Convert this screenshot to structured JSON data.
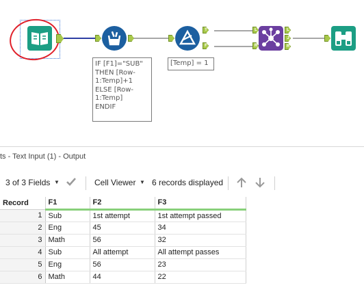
{
  "workflow": {
    "tools": [
      {
        "name": "Text Input",
        "icon": "text-input-book-icon",
        "color": "#1c9e84"
      },
      {
        "name": "Multi-Row Formula",
        "icon": "multi-row-formula-icon",
        "color": "#1c5fa0"
      },
      {
        "name": "Filter",
        "icon": "filter-icon",
        "color": "#1c5fa0"
      },
      {
        "name": "Join",
        "icon": "join-icon",
        "color": "#6b3fa0"
      },
      {
        "name": "Browse",
        "icon": "binoculars-browse-icon",
        "color": "#1c9e84"
      }
    ],
    "anchors": {
      "filter_true": "T",
      "filter_false": "F",
      "join_left_in": "L",
      "join_right_in": "R",
      "join_left_out": "L",
      "join_join_out": "J",
      "join_right_out": "R"
    },
    "annotations": {
      "multirow": "IF [F1]=\"SUB\"\nTHEN [Row-\n1:Temp]+1\nELSE [Row-\n1:Temp]\nENDIF",
      "filter": "[Temp] = 1"
    }
  },
  "results": {
    "title": "ts - Text Input (1) - Output",
    "fields_label": "3 of 3 Fields",
    "viewer_label": "Cell Viewer",
    "records_label": "6 records displayed",
    "columns": [
      "Record",
      "F1",
      "F2",
      "F3"
    ],
    "rows": [
      [
        "1",
        "Sub",
        "1st attempt",
        "1st attempt passed"
      ],
      [
        "2",
        "Eng",
        "45",
        "34"
      ],
      [
        "3",
        "Math",
        "56",
        "32"
      ],
      [
        "4",
        "Sub",
        "All attempt",
        "All attempt passes"
      ],
      [
        "5",
        "Eng",
        "56",
        "23"
      ],
      [
        "6",
        "Math",
        "44",
        "22"
      ]
    ]
  },
  "colors": {
    "accent_green": "#88d07a",
    "anchor_green": "#a8c84a",
    "highlight_red": "#e0202a"
  }
}
